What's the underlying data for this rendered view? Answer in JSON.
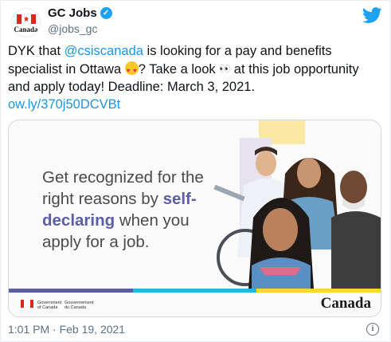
{
  "author": {
    "avatar_wordmark": "Canada",
    "display_name": "GC Jobs",
    "handle": "@jobs_gc"
  },
  "tweet": {
    "part1": "DYK that ",
    "mention": "@csiscanada",
    "part2": " is looking for a pay and benefits specialist in Ottawa ",
    "part3": "? Take a look ",
    "part4": " at this job opportunity and apply today! Deadline: March 3, 2021.",
    "link": "ow.ly/370j50DCVBt",
    "emoji_1": "smiling-face-with-heart-eyes",
    "emoji_2": "eyes"
  },
  "card": {
    "headline_1": "Get recognized for the right reasons by ",
    "headline_emphasis": "self-declaring",
    "headline_2": " when you apply for a job.",
    "gov_en": "Government of Canada",
    "gov_fr": "Gouvernement du Canada",
    "wordmark": "Canada",
    "stripe_colors": [
      "#5b5ea6",
      "#26b5e6",
      "#fdd835"
    ]
  },
  "footer": {
    "timestamp": "1:01 PM · Feb 19, 2021"
  },
  "colors": {
    "link": "#1b95e0",
    "twitter_blue": "#1da1f2",
    "canada_red": "#d52b1e"
  }
}
